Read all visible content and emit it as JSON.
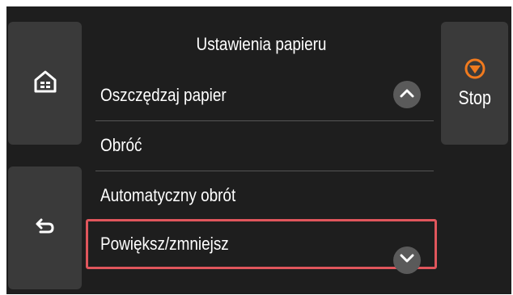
{
  "header": {
    "title": "Ustawienia papieru"
  },
  "menu": {
    "items": [
      {
        "label": "Oszczędzaj papier"
      },
      {
        "label": "Obróć"
      },
      {
        "label": "Automatyczny obrót"
      },
      {
        "label": "Powiększ/zmniejsz"
      }
    ],
    "selected_label": "Powiększ/zmniejsz"
  },
  "buttons": {
    "home_icon": "home-icon",
    "back_icon": "back-arrow-icon",
    "stop_label": "Stop",
    "stop_icon": "stop-icon",
    "scroll_up_icon": "chevron-up-icon",
    "scroll_down_icon": "chevron-down-icon"
  },
  "colors": {
    "screen_bg": "#1e1e1e",
    "button_bg": "#3a3a3a",
    "stop_accent": "#f07a1e",
    "selection_border": "#e0565c"
  }
}
